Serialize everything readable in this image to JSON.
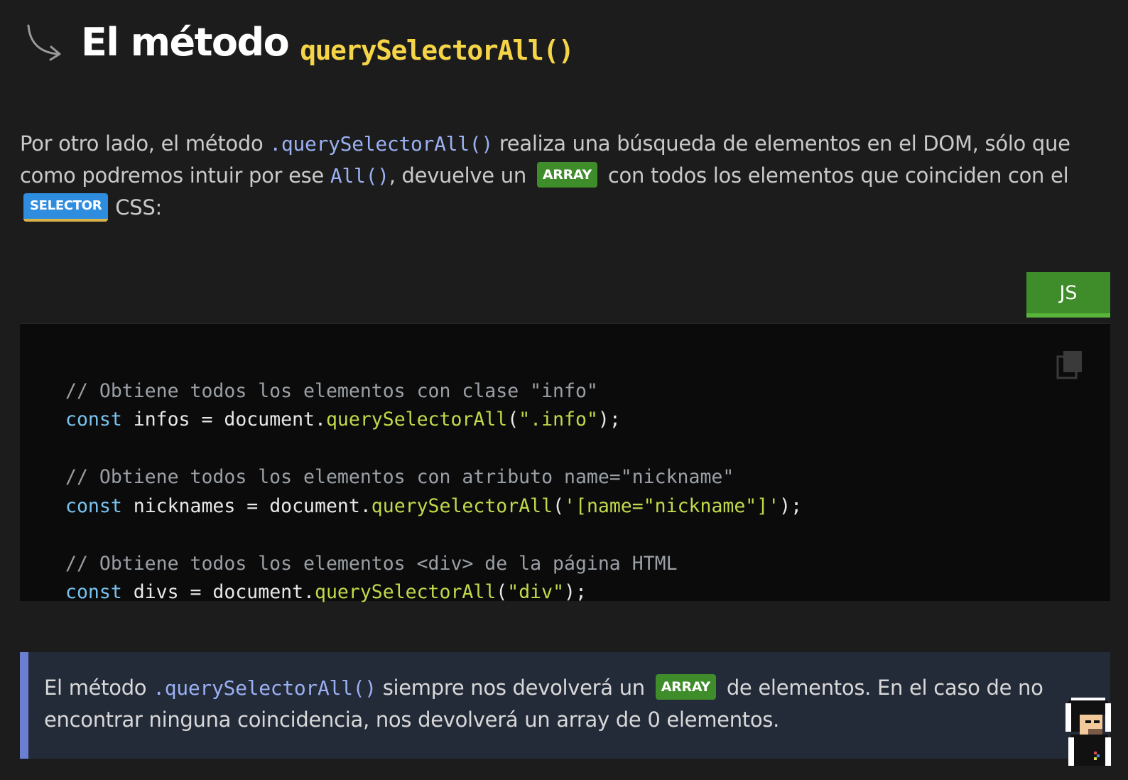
{
  "heading": {
    "title": "El método",
    "code": "querySelectorAll()"
  },
  "paragraph": {
    "part1": "Por otro lado, el método ",
    "code1": ".querySelectorAll()",
    "part2": " realiza una búsqueda de elementos en el DOM, sólo que como podremos intuir por ese ",
    "code2": "All()",
    "part3": ", devuelve un ",
    "badge_array": "ARRAY",
    "part4": " con todos los elementos que coinciden con el ",
    "badge_selector": "SELECTOR",
    "part5": "CSS:"
  },
  "code_block": {
    "language": "JS",
    "lines": [
      {
        "comment": "// Obtiene todos los elementos con clase \"info\""
      },
      {
        "kw": "const",
        "pre": " infos = document.",
        "fn": "querySelectorAll",
        "open": "(",
        "str": "\".info\"",
        "close": ");"
      },
      {
        "blank": ""
      },
      {
        "comment": "// Obtiene todos los elementos con atributo name=\"nickname\""
      },
      {
        "kw": "const",
        "pre": " nicknames = document.",
        "fn": "querySelectorAll",
        "open": "(",
        "str": "'[name=\"nickname\"]'",
        "close": ");"
      },
      {
        "blank": ""
      },
      {
        "comment": "// Obtiene todos los elementos <div> de la página HTML"
      },
      {
        "kw": "const",
        "pre": " divs = document.",
        "fn": "querySelectorAll",
        "open": "(",
        "str": "\"div\"",
        "close": ");"
      }
    ]
  },
  "note": {
    "part1": "El método ",
    "code": ".querySelectorAll()",
    "part2": " siempre nos devolverá un ",
    "badge_array": "ARRAY",
    "part3": " de elementos. En el caso de no encontrar ninguna coincidencia, nos devolverá un array de 0 elementos."
  },
  "colors": {
    "background": "#1c1c1c",
    "heading_code": "#f5d547",
    "inline_code": "#9ab0f2",
    "badge_green": "#3f8c2a",
    "badge_blue": "#2f8de0",
    "note_border": "#6b7fd1"
  },
  "icons": {
    "heading_arrow": "curved-arrow-icon",
    "copy": "copy-icon",
    "avatar": "pixel-avatar"
  }
}
